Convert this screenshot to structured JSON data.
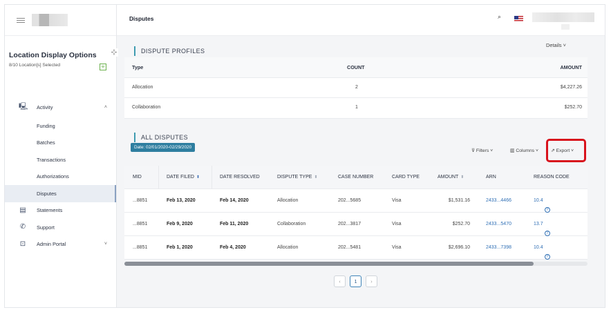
{
  "header": {
    "title": "Disputes"
  },
  "sidebar": {
    "location_title": "Location Display Options",
    "location_sub": "8/10 Location[s] Selected",
    "items": [
      {
        "label": "Activity",
        "icon": "monitor-icon",
        "chevron": "˄"
      },
      {
        "label": "Funding"
      },
      {
        "label": "Batches"
      },
      {
        "label": "Transactions"
      },
      {
        "label": "Authorizations"
      },
      {
        "label": "Disputes"
      },
      {
        "label": "Statements",
        "icon": "document-icon"
      },
      {
        "label": "Support",
        "icon": "phone-icon"
      },
      {
        "label": "Admin Portal",
        "icon": "admin-icon",
        "chevron": "˅"
      }
    ]
  },
  "profiles": {
    "heading": "DISPUTE PROFILES",
    "details": "Details ˅",
    "columns": {
      "type": "Type",
      "count": "COUNT",
      "amount": "AMOUNT"
    },
    "rows": [
      {
        "type": "Allocation",
        "count": "2",
        "amount": "$4,227.26"
      },
      {
        "type": "Collaboration",
        "count": "1",
        "amount": "$252.70"
      }
    ]
  },
  "all_disputes": {
    "heading": "ALL DISPUTES",
    "date_chip": "Date: 02/01/2020-02/29/2020",
    "toolbar": {
      "filters": "Filters ˅",
      "columns": "Columns ˅",
      "export": "Export ˅"
    },
    "columns": {
      "mid": "MID",
      "date_filed": "DATE FILED",
      "date_resolved": "DATE RESOLVED",
      "dispute_type": "DISPUTE TYPE",
      "case_number": "CASE NUMBER",
      "card_type": "CARD TYPE",
      "amount": "AMOUNT",
      "arn": "ARN",
      "reason_code": "REASON CODE"
    },
    "rows": [
      {
        "mid": "...8851",
        "date_filed": "Feb 13, 2020",
        "date_resolved": "Feb 14, 2020",
        "dispute_type": "Allocation",
        "case_number": "202...5685",
        "card_type": "Visa",
        "amount": "$1,531.16",
        "arn": "2433...4466",
        "reason_code": "10.4"
      },
      {
        "mid": "...8851",
        "date_filed": "Feb 9, 2020",
        "date_resolved": "Feb 11, 2020",
        "dispute_type": "Collaboration",
        "case_number": "202...3817",
        "card_type": "Visa",
        "amount": "$252.70",
        "arn": "2433...5470",
        "reason_code": "13.7"
      },
      {
        "mid": "...8851",
        "date_filed": "Feb 1, 2020",
        "date_resolved": "Feb 4, 2020",
        "dispute_type": "Allocation",
        "case_number": "202...5481",
        "card_type": "Visa",
        "amount": "$2,696.10",
        "arn": "2433...7398",
        "reason_code": "10.4"
      }
    ]
  },
  "pagination": {
    "prev": "‹",
    "current": "1",
    "next": "›"
  },
  "colors": {
    "accent": "#3e9bb0",
    "chip": "#2e7ea0",
    "link": "#2f6fb5",
    "highlight": "#d8121c"
  }
}
